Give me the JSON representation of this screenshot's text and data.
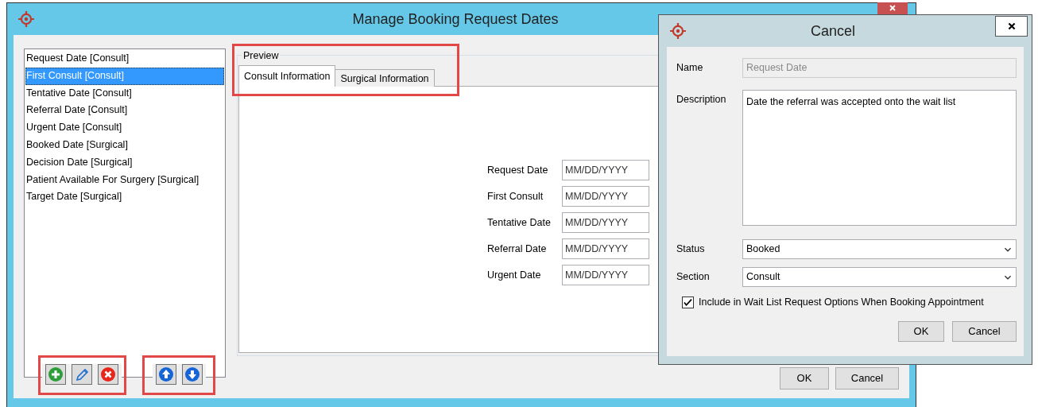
{
  "window": {
    "title": "Manage Booking Request Dates"
  },
  "date_list": {
    "items": [
      {
        "label": "Request Date [Consult]",
        "selected": false
      },
      {
        "label": "First Consult [Consult]",
        "selected": true
      },
      {
        "label": "Tentative Date [Consult]",
        "selected": false
      },
      {
        "label": "Referral Date [Consult]",
        "selected": false
      },
      {
        "label": "Urgent Date [Consult]",
        "selected": false
      },
      {
        "label": "Booked Date [Surgical]",
        "selected": false
      },
      {
        "label": "Decision Date [Surgical]",
        "selected": false
      },
      {
        "label": "Patient Available For Surgery [Surgical]",
        "selected": false
      },
      {
        "label": "Target Date [Surgical]",
        "selected": false
      }
    ]
  },
  "preview": {
    "title": "Preview",
    "tabs": [
      {
        "label": "Consult Information",
        "selected": true
      },
      {
        "label": "Surgical Information",
        "selected": false
      }
    ],
    "fields": [
      {
        "label": "Request Date",
        "placeholder": "MM/DD/YYYY"
      },
      {
        "label": "First Consult",
        "placeholder": "MM/DD/YYYY"
      },
      {
        "label": "Tentative Date",
        "placeholder": "MM/DD/YYYY"
      },
      {
        "label": "Referral Date",
        "placeholder": "MM/DD/YYYY"
      },
      {
        "label": "Urgent Date",
        "placeholder": "MM/DD/YYYY"
      }
    ]
  },
  "buttons": [
    "OK",
    "Cancel"
  ],
  "dialog": {
    "title": "Cancel",
    "name": {
      "label": "Name",
      "value": "Request Date",
      "disabled": true
    },
    "description": {
      "label": "Description",
      "value": "Date the referral was accepted onto the wait list"
    },
    "status": {
      "label": "Status",
      "value": "Booked"
    },
    "section": {
      "label": "Section",
      "value": "Consult"
    },
    "include_option": {
      "label": "Include in Wait List Request Options When Booking Appointment",
      "checked": true
    },
    "buttons": [
      "OK",
      "Cancel"
    ]
  }
}
